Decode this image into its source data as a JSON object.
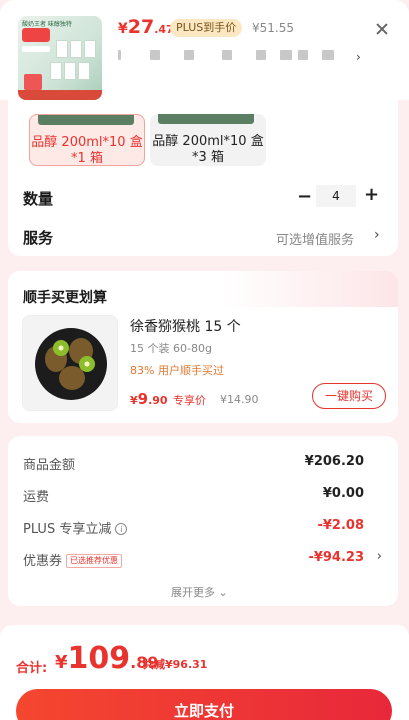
{
  "header": {
    "thumbnail_tag": "酸奶王者 味醇独特",
    "price": {
      "yen": "¥",
      "integer": "27",
      "decimal": ".47"
    },
    "plus_tag": "PLUS到手价",
    "original_price": "¥51.55",
    "selected_chevron": "›",
    "close_icon": "close-icon"
  },
  "options": {
    "items": [
      {
        "label": "品醇 200ml*10 盒*1 箱",
        "selected": true
      },
      {
        "label": "品醇 200ml*10 盒*3 箱",
        "selected": false
      }
    ]
  },
  "quantity": {
    "label": "数量",
    "value": "4",
    "minus": "−",
    "plus": "+"
  },
  "service": {
    "label": "服务",
    "value": "可选增值服务",
    "chevron": "›"
  },
  "addon": {
    "title": "顺手买更划算",
    "product": {
      "name": "徐香猕猴桃 15 个",
      "spec": "15 个装  60-80g",
      "buy_rate": "83% 用户顺手买过",
      "price_yen": "¥",
      "price_int": "9",
      "price_dec": ".90",
      "price_tag": "专享价",
      "original": "¥14.90",
      "buy_button": "一键购买"
    }
  },
  "summary": {
    "rows": [
      {
        "label": "商品金额",
        "value": "¥206.20"
      },
      {
        "label": "运费",
        "value": "¥0.00"
      },
      {
        "label": "PLUS 专享立减",
        "value": "-¥2.08"
      },
      {
        "label": "优惠券",
        "value": "-¥94.23",
        "tag": "已选推荐优惠"
      }
    ],
    "expand": "展开更多 ⌄"
  },
  "footer": {
    "total_label": "合计:",
    "total_yen": "¥",
    "total_int": "109",
    "total_dec": ".89",
    "saved": "共减¥96.31",
    "pay_button": "立即支付"
  },
  "colors": {
    "accent": "#e8332e",
    "plus_tag_bg": "#fbe7c2",
    "page_bg": "#fdeef0"
  }
}
